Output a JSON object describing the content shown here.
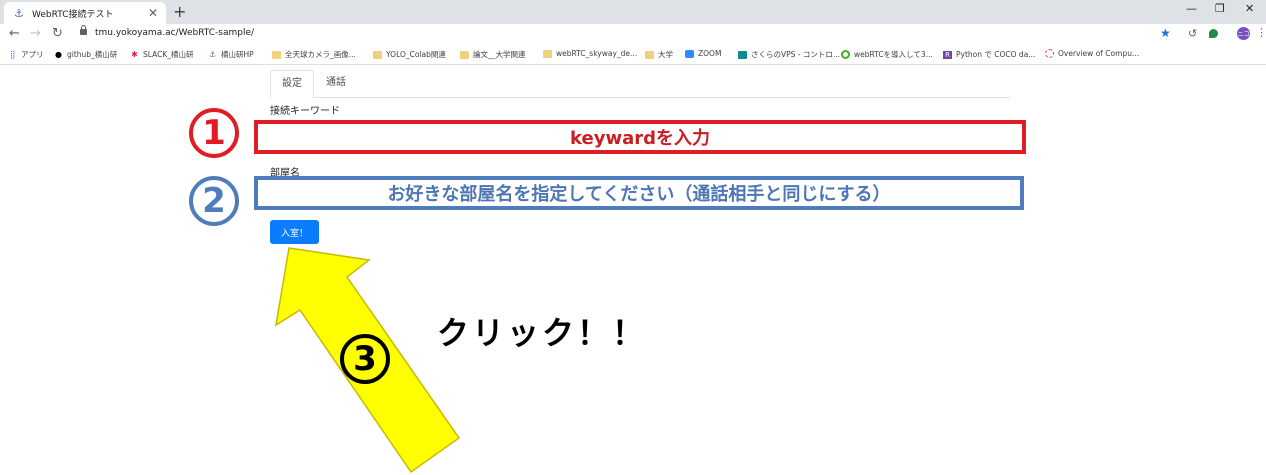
{
  "browser": {
    "tab_title": "WebRTC接続テスト",
    "url": "tmu.yokoyama.ac/WebRTC-sample/",
    "profile_initials": "ニコ",
    "bookmarks": [
      {
        "label": "アプリ"
      },
      {
        "label": "github_横山研"
      },
      {
        "label": "SLACK_横山研"
      },
      {
        "label": "横山研HP"
      },
      {
        "label": "全天球カメラ_画像..."
      },
      {
        "label": "YOLO_Colab関連"
      },
      {
        "label": "論文__大学関連"
      },
      {
        "label": "webRTC_skyway_de..."
      },
      {
        "label": "大学"
      },
      {
        "label": "ZOOM"
      },
      {
        "label": "さくらのVPS - コントロ..."
      },
      {
        "label": "webRTCを導入して3..."
      },
      {
        "label": "Python で COCO da..."
      },
      {
        "label": "Overview of Compu..."
      }
    ]
  },
  "page": {
    "tabs": [
      {
        "label": "設定"
      },
      {
        "label": "通話"
      }
    ],
    "keyword_label": "接続キーワード",
    "room_label": "部屋名",
    "enter_button": "入室！"
  },
  "annotations": {
    "step1_marker": "①",
    "step1_text": "keywardを入力",
    "step2_marker": "②",
    "step2_text": "お好きな部屋名を指定してください（通話相手と同じにする）",
    "step3_marker": "③",
    "step3_text": "クリック！！"
  },
  "colors": {
    "annotation_red": "#e21c25",
    "annotation_blue": "#4f7cbc",
    "button_blue": "#0b7dfc",
    "arrow_yellow": "#ffff00"
  }
}
